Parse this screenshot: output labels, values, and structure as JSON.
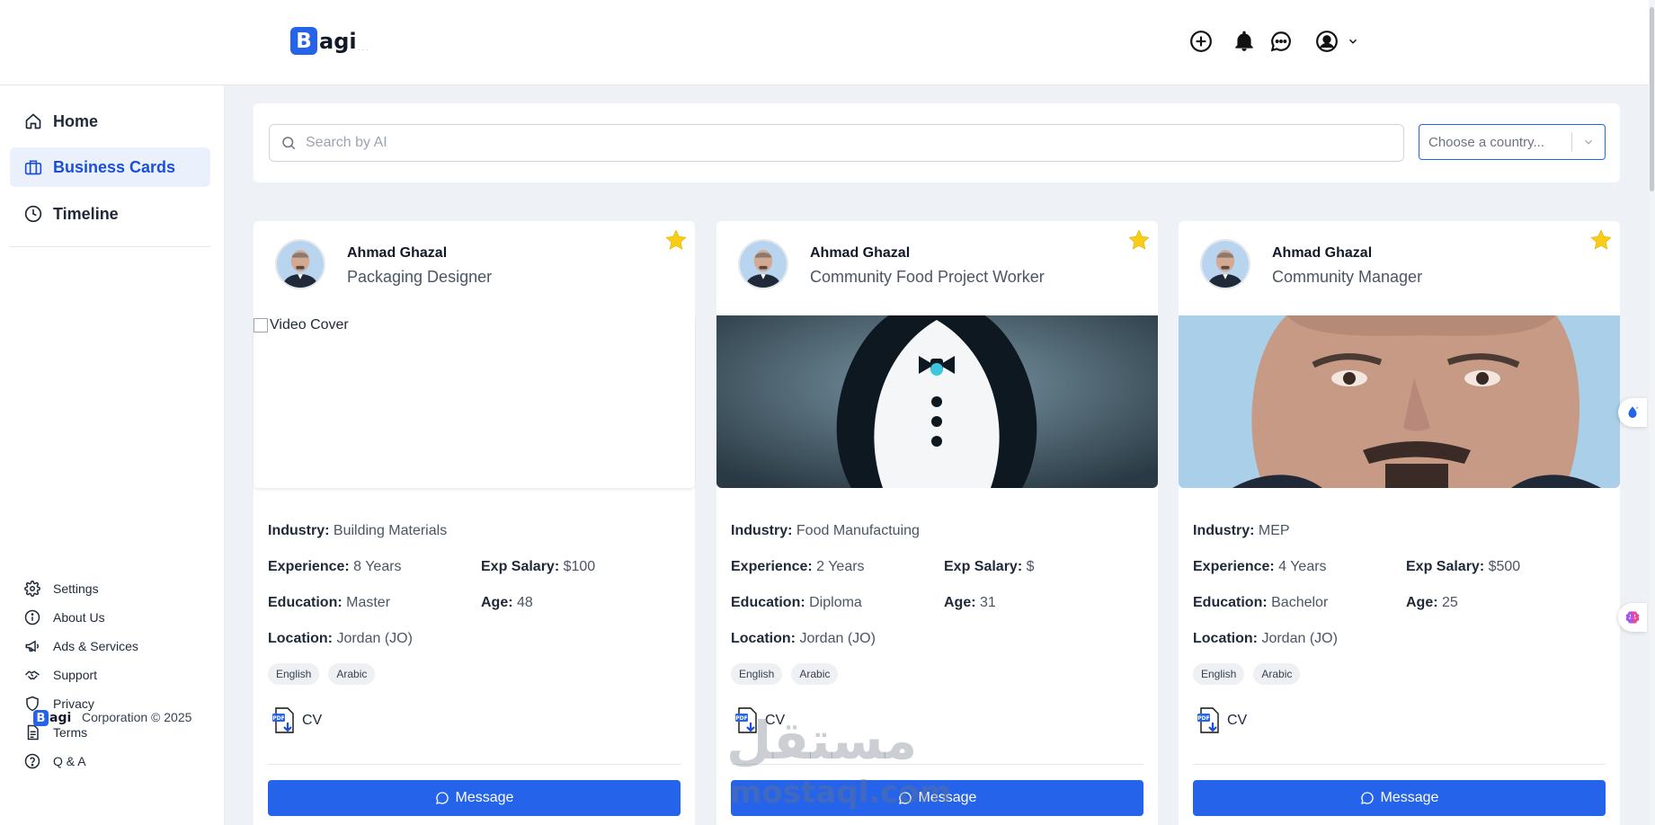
{
  "header": {
    "logo": {
      "letter": "B",
      "rest": "agi",
      "dots": "..."
    },
    "icons": [
      "plus-circle-icon",
      "bell-icon",
      "chat-bubble-icon",
      "user-circle-icon",
      "chevron-down-icon"
    ]
  },
  "sidebar": {
    "nav": [
      {
        "label": "Home",
        "icon": "home-icon",
        "active": false
      },
      {
        "label": "Business Cards",
        "icon": "briefcase-icon",
        "active": true
      },
      {
        "label": "Timeline",
        "icon": "clock-icon",
        "active": false
      }
    ],
    "footer_links": [
      {
        "label": "Settings",
        "icon": "gear-icon"
      },
      {
        "label": "About Us",
        "icon": "info-icon"
      },
      {
        "label": "Ads & Services",
        "icon": "megaphone-icon"
      },
      {
        "label": "Support",
        "icon": "handshake-icon"
      },
      {
        "label": "Privacy",
        "icon": "shield-icon"
      },
      {
        "label": "Terms",
        "icon": "document-icon"
      },
      {
        "label": "Q & A",
        "icon": "question-icon"
      }
    ],
    "copyright": "Corporation © 2025"
  },
  "search": {
    "placeholder": "Search by AI",
    "country_placeholder": "Choose a country..."
  },
  "labels": {
    "industry": "Industry:",
    "experience": "Experience:",
    "salary": "Exp Salary:",
    "education": "Education:",
    "age": "Age:",
    "location": "Location:",
    "cv": "CV",
    "message": "Message",
    "video_alt": "Video Cover"
  },
  "cards": [
    {
      "name": "Ahmad Ghazal",
      "role": "Packaging Designer",
      "media": "broken",
      "industry": "Building Materials",
      "experience": "8 Years",
      "salary": "$100",
      "education": "Master",
      "age": "48",
      "location": "Jordan (JO)",
      "languages": [
        "English",
        "Arabic"
      ]
    },
    {
      "name": "Ahmad Ghazal",
      "role": "Community Food Project Worker",
      "media": "penguin",
      "industry": "Food Manufactuing",
      "experience": "2 Years",
      "salary": "$",
      "education": "Diploma",
      "age": "31",
      "location": "Jordan (JO)",
      "languages": [
        "English",
        "Arabic"
      ]
    },
    {
      "name": "Ahmad Ghazal",
      "role": "Community Manager",
      "media": "portrait",
      "industry": "MEP",
      "experience": "4 Years",
      "salary": "$500",
      "education": "Bachelor",
      "age": "25",
      "location": "Jordan (JO)",
      "languages": [
        "English",
        "Arabic"
      ]
    }
  ],
  "watermark": {
    "arabic": "مستقل",
    "latin": "mostaql.com"
  },
  "colors": {
    "accent": "#2563eb",
    "active_bg": "#eaf1fd",
    "star": "#facc15",
    "page_bg": "#eef2f7"
  }
}
